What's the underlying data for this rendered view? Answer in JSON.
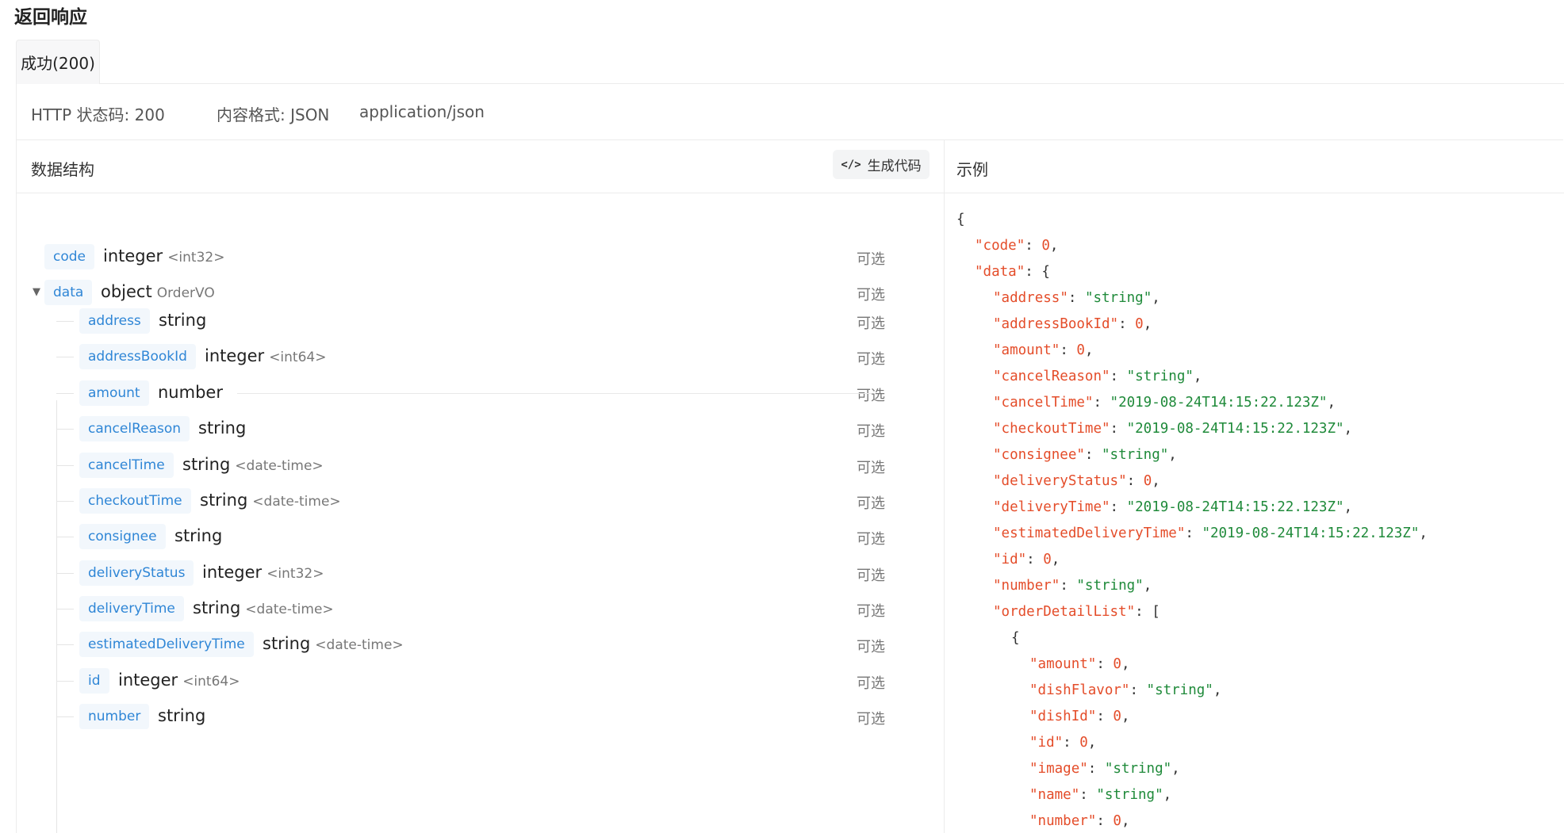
{
  "page_title": "返回响应",
  "tab": {
    "label": "成功(200)"
  },
  "meta": {
    "status": "HTTP 状态码: 200",
    "format": "内容格式: JSON",
    "mime": "application/json"
  },
  "structure": {
    "title": "数据结构",
    "generate_code_label": "生成代码",
    "optional_label": "可选",
    "fields": [
      {
        "name": "code",
        "type": "integer",
        "format": "<int32>"
      },
      {
        "name": "data",
        "type": "object",
        "format": "OrderVO"
      },
      {
        "name": "address",
        "type": "string",
        "format": ""
      },
      {
        "name": "addressBookId",
        "type": "integer",
        "format": "<int64>"
      },
      {
        "name": "amount",
        "type": "number",
        "format": ""
      },
      {
        "name": "cancelReason",
        "type": "string",
        "format": ""
      },
      {
        "name": "cancelTime",
        "type": "string",
        "format": "<date-time>"
      },
      {
        "name": "checkoutTime",
        "type": "string",
        "format": "<date-time>"
      },
      {
        "name": "consignee",
        "type": "string",
        "format": ""
      },
      {
        "name": "deliveryStatus",
        "type": "integer",
        "format": "<int32>"
      },
      {
        "name": "deliveryTime",
        "type": "string",
        "format": "<date-time>"
      },
      {
        "name": "estimatedDeliveryTime",
        "type": "string",
        "format": "<date-time>"
      },
      {
        "name": "id",
        "type": "integer",
        "format": "<int64>"
      },
      {
        "name": "number",
        "type": "string",
        "format": ""
      }
    ]
  },
  "example": {
    "title": "示例",
    "lines": [
      {
        "indent": 0,
        "text": "{"
      },
      {
        "indent": 1,
        "key": "code",
        "value": "0",
        "kind": "num",
        "trail": ","
      },
      {
        "indent": 1,
        "key": "data",
        "value": "{",
        "kind": "punct",
        "trail": ""
      },
      {
        "indent": 2,
        "key": "address",
        "value": "\"string\"",
        "kind": "str",
        "trail": ","
      },
      {
        "indent": 2,
        "key": "addressBookId",
        "value": "0",
        "kind": "num",
        "trail": ","
      },
      {
        "indent": 2,
        "key": "amount",
        "value": "0",
        "kind": "num",
        "trail": ","
      },
      {
        "indent": 2,
        "key": "cancelReason",
        "value": "\"string\"",
        "kind": "str",
        "trail": ","
      },
      {
        "indent": 2,
        "key": "cancelTime",
        "value": "\"2019-08-24T14:15:22.123Z\"",
        "kind": "str",
        "trail": ","
      },
      {
        "indent": 2,
        "key": "checkoutTime",
        "value": "\"2019-08-24T14:15:22.123Z\"",
        "kind": "str",
        "trail": ","
      },
      {
        "indent": 2,
        "key": "consignee",
        "value": "\"string\"",
        "kind": "str",
        "trail": ","
      },
      {
        "indent": 2,
        "key": "deliveryStatus",
        "value": "0",
        "kind": "num",
        "trail": ","
      },
      {
        "indent": 2,
        "key": "deliveryTime",
        "value": "\"2019-08-24T14:15:22.123Z\"",
        "kind": "str",
        "trail": ","
      },
      {
        "indent": 2,
        "key": "estimatedDeliveryTime",
        "value": "\"2019-08-24T14:15:22.123Z\"",
        "kind": "str",
        "trail": ","
      },
      {
        "indent": 2,
        "key": "id",
        "value": "0",
        "kind": "num",
        "trail": ","
      },
      {
        "indent": 2,
        "key": "number",
        "value": "\"string\"",
        "kind": "str",
        "trail": ","
      },
      {
        "indent": 2,
        "key": "orderDetailList",
        "value": "[",
        "kind": "punct",
        "trail": ""
      },
      {
        "indent": 3,
        "text": "{"
      },
      {
        "indent": 4,
        "key": "amount",
        "value": "0",
        "kind": "num",
        "trail": ","
      },
      {
        "indent": 4,
        "key": "dishFlavor",
        "value": "\"string\"",
        "kind": "str",
        "trail": ","
      },
      {
        "indent": 4,
        "key": "dishId",
        "value": "0",
        "kind": "num",
        "trail": ","
      },
      {
        "indent": 4,
        "key": "id",
        "value": "0",
        "kind": "num",
        "trail": ","
      },
      {
        "indent": 4,
        "key": "image",
        "value": "\"string\"",
        "kind": "str",
        "trail": ","
      },
      {
        "indent": 4,
        "key": "name",
        "value": "\"string\"",
        "kind": "str",
        "trail": ","
      },
      {
        "indent": 4,
        "key": "number",
        "value": "0",
        "kind": "num",
        "trail": ","
      }
    ]
  }
}
